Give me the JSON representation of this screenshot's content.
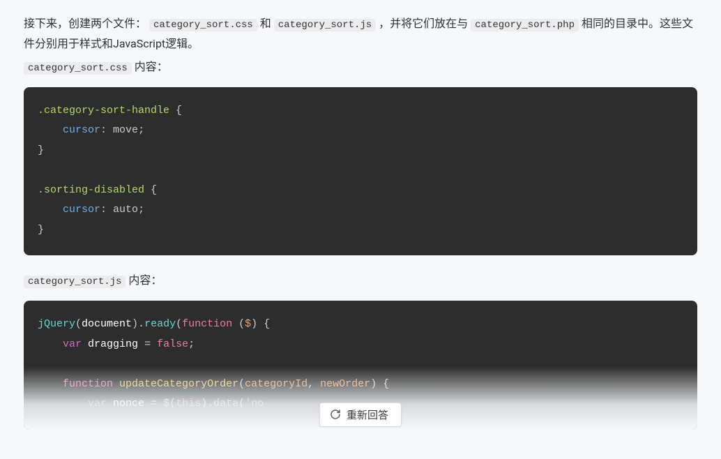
{
  "intro": {
    "t1": "接下来，创建两个文件：",
    "code1": "category_sort.css",
    "t2": " 和 ",
    "code2": "category_sort.js",
    "t3": " ，并将它们放在与 ",
    "code3": "category_sort.php",
    "t4": " 相同的目录中。这些文件分别用于样式和JavaScript逻辑。"
  },
  "css_label": {
    "code": "category_sort.css",
    "suffix": " 内容："
  },
  "css_code": {
    "sel1": ".category-sort-handle",
    "brace_open": " {",
    "prop1": "cursor",
    "val_move": "move",
    "brace_close": "}",
    "sel2": ".sorting-disabled",
    "prop2": "cursor",
    "val_auto": "auto"
  },
  "js_label": {
    "code": "category_sort.js",
    "suffix": " 内容："
  },
  "js_code": {
    "jquery": "jQuery",
    "document": "document",
    "ready": "ready",
    "function": "function",
    "dollar": "$",
    "var": "var",
    "dragging": "dragging",
    "false": "false",
    "updateCategoryOrder": "updateCategoryOrder",
    "categoryId": "categoryId",
    "newOrder": "newOrder",
    "nonce": "nonce",
    "this": "this",
    "data": "data",
    "str_partial": "'no"
  },
  "button": {
    "label": "重新回答"
  }
}
